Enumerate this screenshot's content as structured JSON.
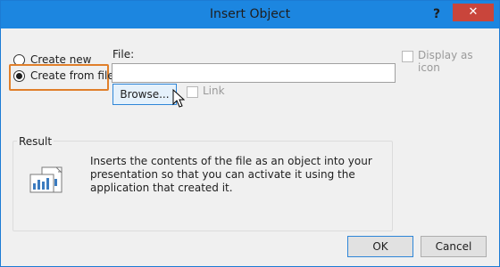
{
  "window": {
    "title": "Insert Object",
    "help_glyph": "?",
    "close_glyph": "✕"
  },
  "options": {
    "create_new_label": "Create new",
    "create_from_file_label": "Create from file",
    "selected": "create_from_file"
  },
  "file": {
    "label": "File:",
    "value": "",
    "browse_label": "Browse...",
    "link_label": "Link",
    "link_checked": false
  },
  "display_as_icon": {
    "label": "Display as icon",
    "checked": false
  },
  "result": {
    "legend": "Result",
    "text": "Inserts the contents of the file as an object into your presentation so that you can activate it using the application that created it."
  },
  "buttons": {
    "ok_label": "OK",
    "cancel_label": "Cancel"
  },
  "colors": {
    "titlebar": "#1c86e0",
    "close": "#c9453b",
    "highlight": "#e07f2a",
    "focus": "#2e86d8"
  },
  "icons": {
    "cursor": "pointer-arrow-icon",
    "result": "embedded-document-icon"
  }
}
